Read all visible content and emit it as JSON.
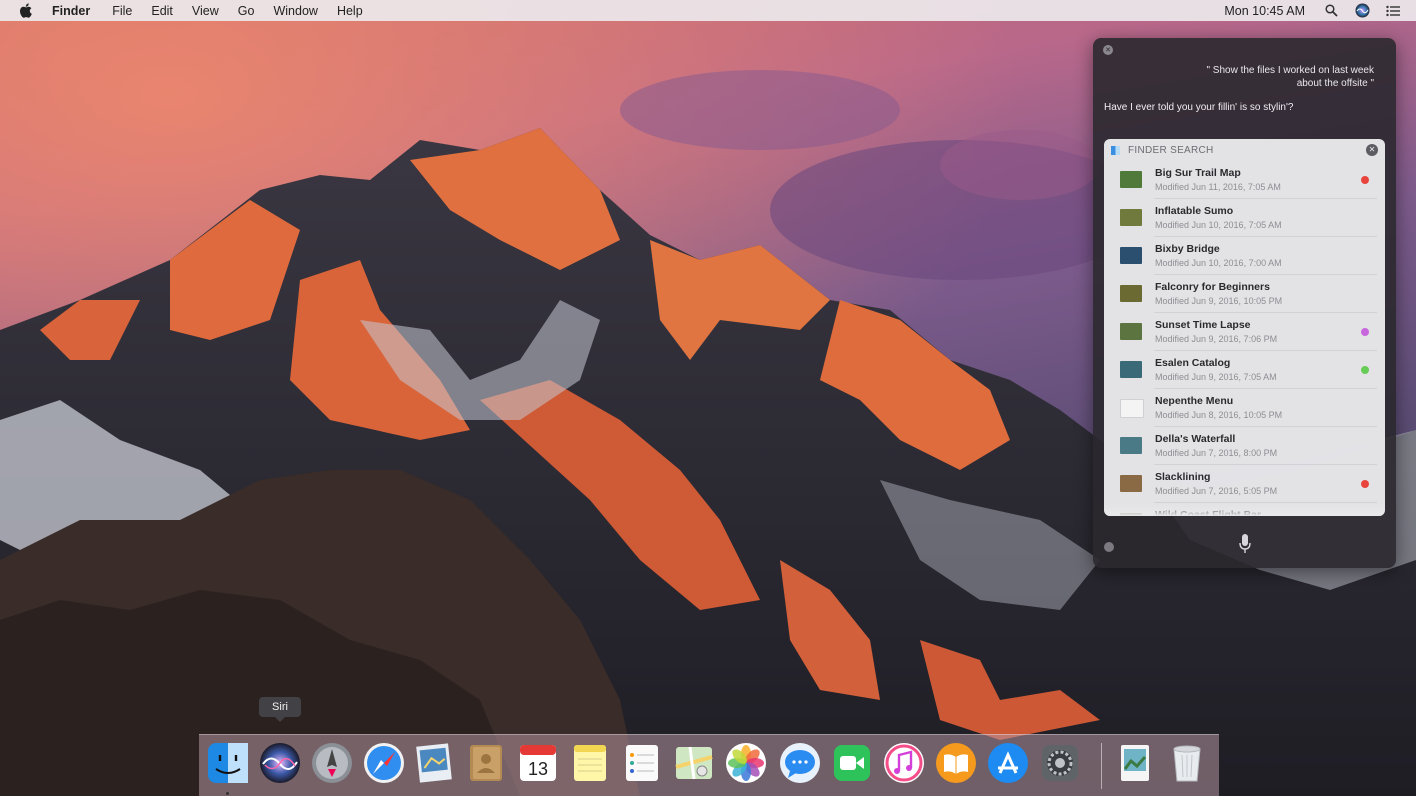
{
  "menubar": {
    "apple_icon": "apple-icon",
    "app_name": "Finder",
    "menus": [
      "File",
      "Edit",
      "View",
      "Go",
      "Window",
      "Help"
    ],
    "clock": "Mon 10:45 AM",
    "status_icons": [
      "spotlight-icon",
      "siri-icon",
      "notification-center-icon"
    ]
  },
  "siri": {
    "query": "\" Show the files I worked on last week about the offsite \"",
    "reply": "Have I ever told you your fillin' is so stylin'?",
    "results": {
      "title": "FINDER SEARCH",
      "items": [
        {
          "name": "Big Sur Trail Map",
          "meta": "Modified Jun 11, 2016, 7:05 AM",
          "tag": "#e8443c",
          "thumb": "#4f7a3a"
        },
        {
          "name": "Inflatable Sumo",
          "meta": "Modified Jun 10, 2016, 7:05 AM",
          "tag": "",
          "thumb": "#6f7a3c"
        },
        {
          "name": "Bixby Bridge",
          "meta": "Modified Jun 10, 2016, 7:00 AM",
          "tag": "",
          "thumb": "#2b4f6e"
        },
        {
          "name": "Falconry for Beginners",
          "meta": "Modified Jun 9, 2016, 10:05 PM",
          "tag": "",
          "thumb": "#6b6a33"
        },
        {
          "name": "Sunset Time Lapse",
          "meta": "Modified Jun 9, 2016, 7:06 PM",
          "tag": "#c866dd",
          "thumb": "#5c7440"
        },
        {
          "name": "Esalen Catalog",
          "meta": "Modified Jun 9, 2016, 7:05 AM",
          "tag": "#66cc55",
          "thumb": "#3a6a77"
        },
        {
          "name": "Nepenthe Menu",
          "meta": "Modified Jun 8, 2016, 10:05 PM",
          "tag": "",
          "thumb": "#f4f4f4"
        },
        {
          "name": "Della's Waterfall",
          "meta": "Modified Jun 7, 2016, 8:00 PM",
          "tag": "",
          "thumb": "#4a7a86"
        },
        {
          "name": "Slacklining",
          "meta": "Modified Jun 7, 2016, 5:05 PM",
          "tag": "#e8443c",
          "thumb": "#8a6a44"
        },
        {
          "name": "Wild Coast Flight Bar",
          "meta": "",
          "tag": "",
          "thumb": "#7a7a55"
        }
      ]
    },
    "settings_icon": "siri-settings-icon",
    "mic_icon": "microphone-icon"
  },
  "dock": {
    "tooltip": "Siri",
    "apps": [
      {
        "name": "finder-icon",
        "running": true
      },
      {
        "name": "siri-dock-icon",
        "running": false
      },
      {
        "name": "launchpad-icon",
        "running": false
      },
      {
        "name": "safari-icon",
        "running": false
      },
      {
        "name": "preview-icon",
        "running": false
      },
      {
        "name": "contacts-icon",
        "running": false
      },
      {
        "name": "calendar-icon",
        "running": false,
        "day": "13"
      },
      {
        "name": "notes-icon",
        "running": false
      },
      {
        "name": "reminders-icon",
        "running": false
      },
      {
        "name": "maps-icon",
        "running": false
      },
      {
        "name": "photos-icon",
        "running": false
      },
      {
        "name": "messages-icon",
        "running": false
      },
      {
        "name": "facetime-icon",
        "running": false
      },
      {
        "name": "itunes-icon",
        "running": false
      },
      {
        "name": "ibooks-icon",
        "running": false
      },
      {
        "name": "app-store-icon",
        "running": false
      },
      {
        "name": "system-preferences-icon",
        "running": false
      },
      {
        "name": "preview-document-icon",
        "running": false
      },
      {
        "name": "trash-icon",
        "running": false
      }
    ]
  }
}
